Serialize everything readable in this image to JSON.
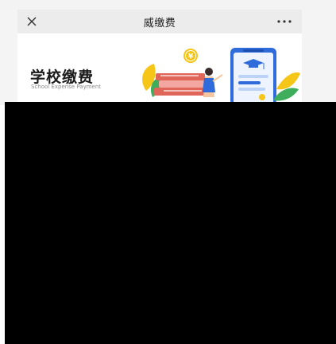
{
  "header": {
    "title": "威缴费"
  },
  "banner": {
    "title": "学校缴费",
    "subtitle": "School Expense Payment",
    "coin_symbol": "¥"
  },
  "colors": {
    "header_bg": "#ececec",
    "accent_blue": "#2f6bdb",
    "accent_yellow": "#f5c518",
    "leaf_green": "#3fae5c",
    "book_red": "#e0665a"
  }
}
